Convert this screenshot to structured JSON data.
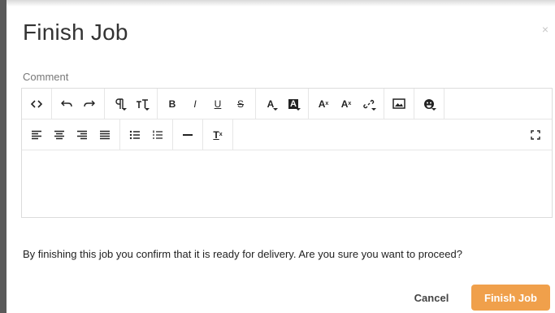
{
  "dialog": {
    "title": "Finish Job",
    "close_glyph": "×",
    "comment_label": "Comment",
    "message": "By finishing this job you confirm that it is ready for delivery. Are you sure you want to proceed?",
    "cancel_label": "Cancel",
    "finish_label": "Finish Job",
    "colors": {
      "accent": "#f0a04b",
      "text": "#222222",
      "muted": "#777777"
    }
  },
  "toolbar": {
    "row1": [
      {
        "icon": "code-view-icon"
      },
      {
        "icon": "undo-icon"
      },
      {
        "icon": "redo-icon"
      },
      {
        "icon": "paragraph-format-icon"
      },
      {
        "icon": "font-size-icon"
      },
      {
        "icon": "bold-icon",
        "text": "B"
      },
      {
        "icon": "italic-icon",
        "text": "I"
      },
      {
        "icon": "underline-icon",
        "text": "U"
      },
      {
        "icon": "strikethrough-icon",
        "text": "S"
      },
      {
        "icon": "text-color-icon",
        "text": "A"
      },
      {
        "icon": "background-color-icon",
        "text": "A"
      },
      {
        "icon": "superscript-icon",
        "text": "A"
      },
      {
        "icon": "subscript-icon",
        "text": "A"
      },
      {
        "icon": "link-icon"
      },
      {
        "icon": "image-icon"
      },
      {
        "icon": "emoji-icon"
      }
    ],
    "row2": [
      {
        "icon": "align-left-icon"
      },
      {
        "icon": "align-center-icon"
      },
      {
        "icon": "align-right-icon"
      },
      {
        "icon": "align-justify-icon"
      },
      {
        "icon": "unordered-list-icon"
      },
      {
        "icon": "ordered-list-icon"
      },
      {
        "icon": "horizontal-rule-icon"
      },
      {
        "icon": "clear-format-icon",
        "text": "T"
      },
      {
        "icon": "fullscreen-icon"
      }
    ]
  }
}
